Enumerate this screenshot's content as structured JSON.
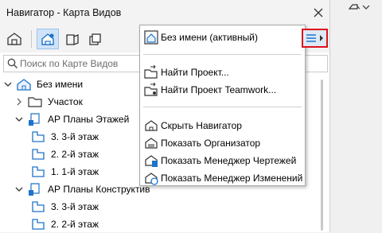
{
  "window": {
    "title": "Навигатор - Карта Видов"
  },
  "search": {
    "placeholder": "Поиск по Карте Видов"
  },
  "toolbar": {
    "buttons": [
      {
        "icon": "project-map-icon"
      },
      {
        "icon": "view-map-icon",
        "active": true
      },
      {
        "icon": "layout-book-icon"
      },
      {
        "icon": "publisher-sets-icon"
      }
    ]
  },
  "tree": {
    "items": [
      {
        "label": "Без имени",
        "level": 0,
        "expanded": true,
        "icon": "project-icon"
      },
      {
        "label": "Участок",
        "level": 1,
        "expanded": false,
        "icon": "folder-icon"
      },
      {
        "label": "АР Планы Этажей",
        "level": 1,
        "expanded": true,
        "icon": "folder-set-icon"
      },
      {
        "label": "3. 3-й этаж",
        "level": 2,
        "icon": "floor-plan-icon"
      },
      {
        "label": "2. 2-й этаж",
        "level": 2,
        "icon": "floor-plan-icon"
      },
      {
        "label": "1. 1-й этаж",
        "level": 2,
        "icon": "floor-plan-icon"
      },
      {
        "label": "АР Планы Конструктив",
        "level": 1,
        "expanded": true,
        "icon": "folder-set-icon"
      },
      {
        "label": "3. 3-й этаж",
        "level": 2,
        "icon": "floor-plan-icon"
      },
      {
        "label": "2. 2-й этаж",
        "level": 2,
        "icon": "floor-plan-icon"
      }
    ]
  },
  "menu": {
    "header": "Без имени (активный)",
    "items": [
      {
        "label": "Найти Проект...",
        "icon": "find-project-icon",
        "group": 1
      },
      {
        "label": "Найти Проект Teamwork...",
        "icon": "find-teamwork-icon",
        "group": 1
      },
      {
        "label": "Скрыть Навигатор",
        "icon": "hide-navigator-icon",
        "group": 2
      },
      {
        "label": "Показать Организатор",
        "icon": "organizer-icon",
        "group": 2
      },
      {
        "label": "Показать Менеджер Чертежей",
        "icon": "drawing-manager-icon",
        "group": 2
      },
      {
        "label": "Показать Менеджер Изменений",
        "icon": "change-manager-icon",
        "group": 2
      }
    ]
  },
  "colors": {
    "accent": "#1e73c8",
    "highlight": "#e0101c",
    "active_bg": "#cfe3f8"
  }
}
